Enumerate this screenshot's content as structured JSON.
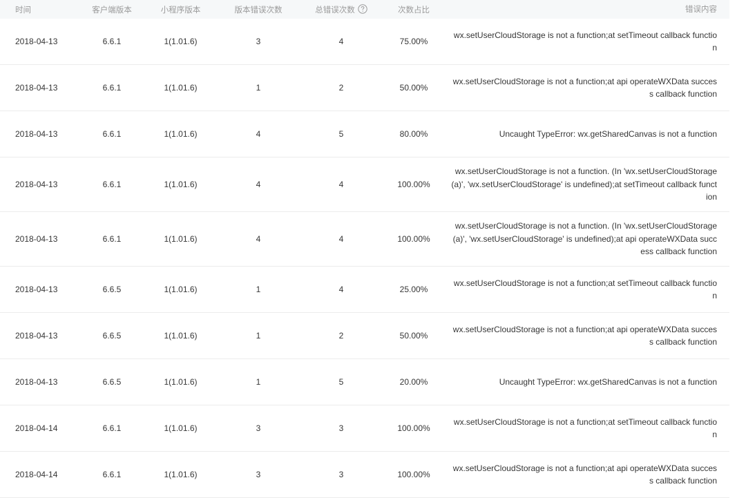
{
  "table": {
    "headers": [
      "时间",
      "客户端版本",
      "小程序版本",
      "版本错误次数",
      "总错误次数",
      "次数占比",
      "错误内容"
    ],
    "rows": [
      {
        "date": "2018-04-13",
        "client_version": "6.6.1",
        "app_version": "1(1.01.6)",
        "version_errors": "3",
        "total_errors": "4",
        "ratio": "75.00%",
        "content": "wx.setUserCloudStorage is not a function;at setTimeout callback function"
      },
      {
        "date": "2018-04-13",
        "client_version": "6.6.1",
        "app_version": "1(1.01.6)",
        "version_errors": "1",
        "total_errors": "2",
        "ratio": "50.00%",
        "content": "wx.setUserCloudStorage is not a function;at api operateWXData success callback function"
      },
      {
        "date": "2018-04-13",
        "client_version": "6.6.1",
        "app_version": "1(1.01.6)",
        "version_errors": "4",
        "total_errors": "5",
        "ratio": "80.00%",
        "content": "Uncaught TypeError: wx.getSharedCanvas is not a function"
      },
      {
        "date": "2018-04-13",
        "client_version": "6.6.1",
        "app_version": "1(1.01.6)",
        "version_errors": "4",
        "total_errors": "4",
        "ratio": "100.00%",
        "content": "wx.setUserCloudStorage is not a function. (In 'wx.setUserCloudStorage(a)', 'wx.setUserCloudStorage' is undefined);at setTimeout callback function"
      },
      {
        "date": "2018-04-13",
        "client_version": "6.6.1",
        "app_version": "1(1.01.6)",
        "version_errors": "4",
        "total_errors": "4",
        "ratio": "100.00%",
        "content": "wx.setUserCloudStorage is not a function. (In 'wx.setUserCloudStorage(a)', 'wx.setUserCloudStorage' is undefined);at api operateWXData success callback function"
      },
      {
        "date": "2018-04-13",
        "client_version": "6.6.5",
        "app_version": "1(1.01.6)",
        "version_errors": "1",
        "total_errors": "4",
        "ratio": "25.00%",
        "content": "wx.setUserCloudStorage is not a function;at setTimeout callback function"
      },
      {
        "date": "2018-04-13",
        "client_version": "6.6.5",
        "app_version": "1(1.01.6)",
        "version_errors": "1",
        "total_errors": "2",
        "ratio": "50.00%",
        "content": "wx.setUserCloudStorage is not a function;at api operateWXData success callback function"
      },
      {
        "date": "2018-04-13",
        "client_version": "6.6.5",
        "app_version": "1(1.01.6)",
        "version_errors": "1",
        "total_errors": "5",
        "ratio": "20.00%",
        "content": "Uncaught TypeError: wx.getSharedCanvas is not a function"
      },
      {
        "date": "2018-04-14",
        "client_version": "6.6.1",
        "app_version": "1(1.01.6)",
        "version_errors": "3",
        "total_errors": "3",
        "ratio": "100.00%",
        "content": "wx.setUserCloudStorage is not a function;at setTimeout callback function"
      },
      {
        "date": "2018-04-14",
        "client_version": "6.6.1",
        "app_version": "1(1.01.6)",
        "version_errors": "3",
        "total_errors": "3",
        "ratio": "100.00%",
        "content": "wx.setUserCloudStorage is not a function;at api operateWXData success callback function"
      }
    ]
  },
  "icons": {
    "help": "question-circle-icon"
  },
  "colors": {
    "header_bg": "#f6f8f9",
    "header_text": "#9a9a9a",
    "body_text": "#353535",
    "divider": "#ececec"
  }
}
